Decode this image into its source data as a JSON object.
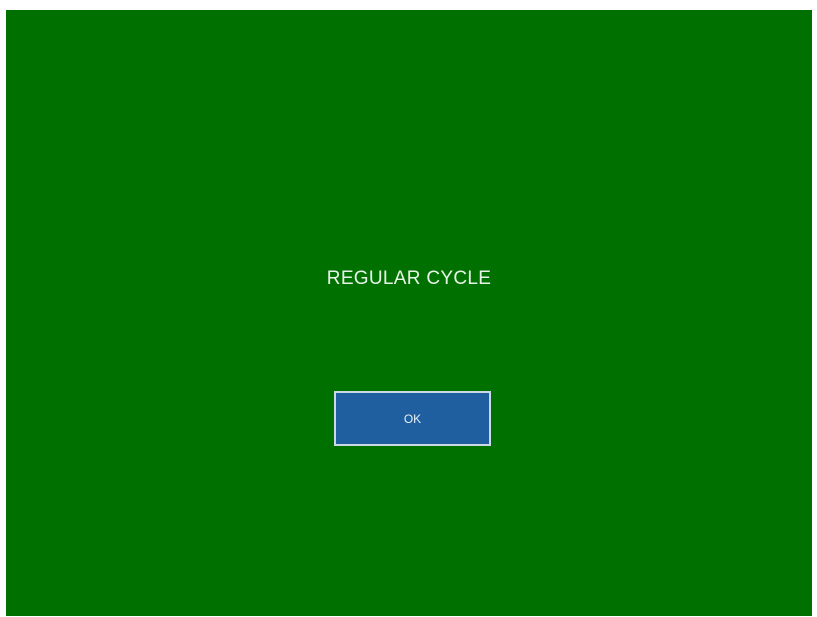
{
  "dialog": {
    "message": "REGULAR CYCLE",
    "ok_label": "OK"
  },
  "colors": {
    "background": "#007100",
    "button": "#1f5fa0",
    "text": "#e8f3e8"
  }
}
